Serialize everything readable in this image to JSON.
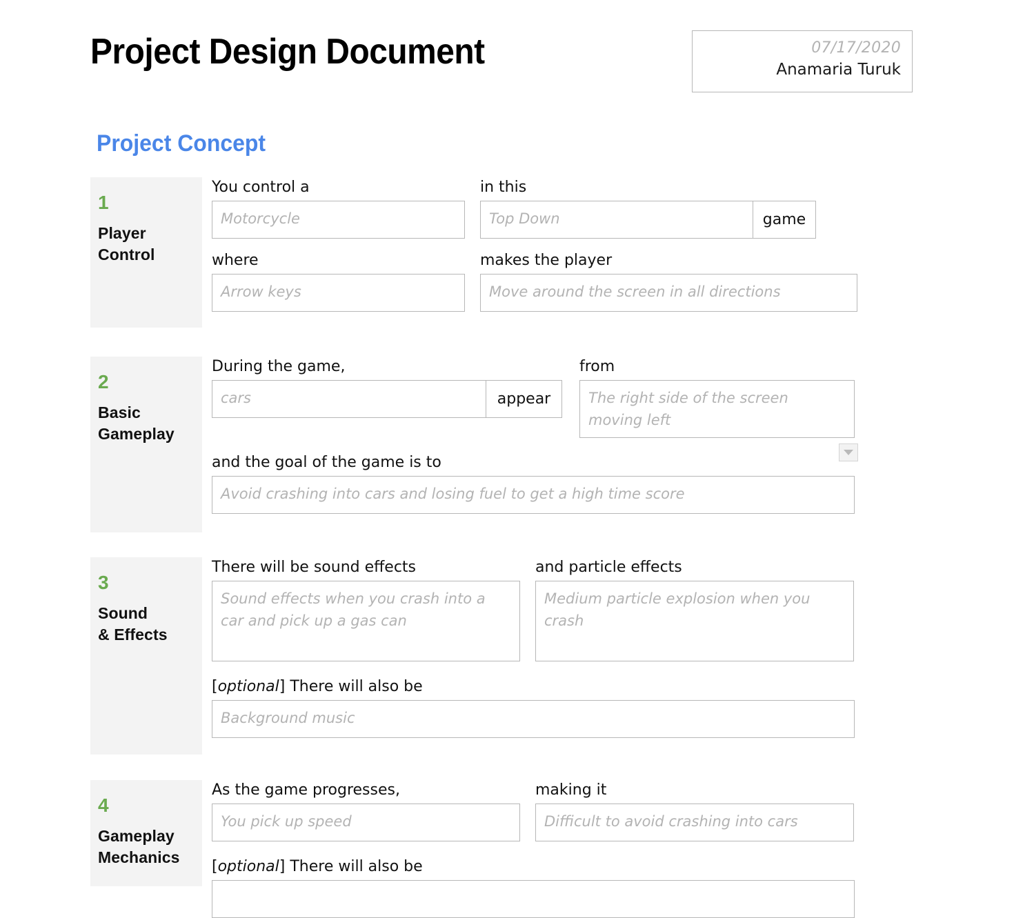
{
  "document": {
    "title": "Project Design Document",
    "date": "07/17/2020",
    "author": "Anamaria Turuk",
    "section_heading": "Project Concept"
  },
  "colors": {
    "heading_blue": "#4a86e8",
    "number_green": "#6aaa4f",
    "aside_gray": "#f3f3f3",
    "border_gray": "#b7b7b7",
    "placeholder_gray": "#b3b3b3"
  },
  "blocks": [
    {
      "number": "1",
      "name_line1": "Player",
      "name_line2": "Control",
      "fields": [
        {
          "label": "You control a",
          "value": "Motorcycle",
          "suffix": ""
        },
        {
          "label": "in this",
          "value": "Top Down",
          "suffix": "game"
        },
        {
          "label": "where",
          "value": "Arrow keys",
          "suffix": ""
        },
        {
          "label": "makes the player",
          "value": "Move around the screen in all directions",
          "suffix": ""
        }
      ]
    },
    {
      "number": "2",
      "name_line1": "Basic",
      "name_line2": "Gameplay",
      "fields": [
        {
          "label": "During the game,",
          "value": "cars",
          "suffix": "appear"
        },
        {
          "label": "from",
          "value": "The right side of the screen moving left",
          "suffix": ""
        },
        {
          "label": "and the goal of the game is to",
          "value": "Avoid crashing into cars and losing fuel to get a high time score",
          "suffix": ""
        }
      ]
    },
    {
      "number": "3",
      "name_line1": "Sound",
      "name_line2": "& Effects",
      "fields": [
        {
          "label": "There will be sound effects",
          "value": "Sound effects when you crash into a car and pick up a gas can",
          "suffix": ""
        },
        {
          "label": "and particle effects",
          "value": "Medium particle explosion when you crash",
          "suffix": ""
        },
        {
          "label_optional": "optional",
          "label": "] There will also be",
          "value": "Background music",
          "suffix": ""
        }
      ]
    },
    {
      "number": "4",
      "name_line1": "Gameplay",
      "name_line2": "Mechanics",
      "fields": [
        {
          "label": "As the game progresses,",
          "value": "You pick up speed",
          "suffix": ""
        },
        {
          "label": "making it",
          "value": "Difficult to avoid crashing into cars",
          "suffix": ""
        },
        {
          "label_optional": "optional",
          "label": "] There will also be",
          "value": "",
          "suffix": ""
        }
      ]
    }
  ],
  "labels": {
    "optional_open": "[",
    "optional_word": "optional",
    "optional_close": "] There will also be"
  }
}
